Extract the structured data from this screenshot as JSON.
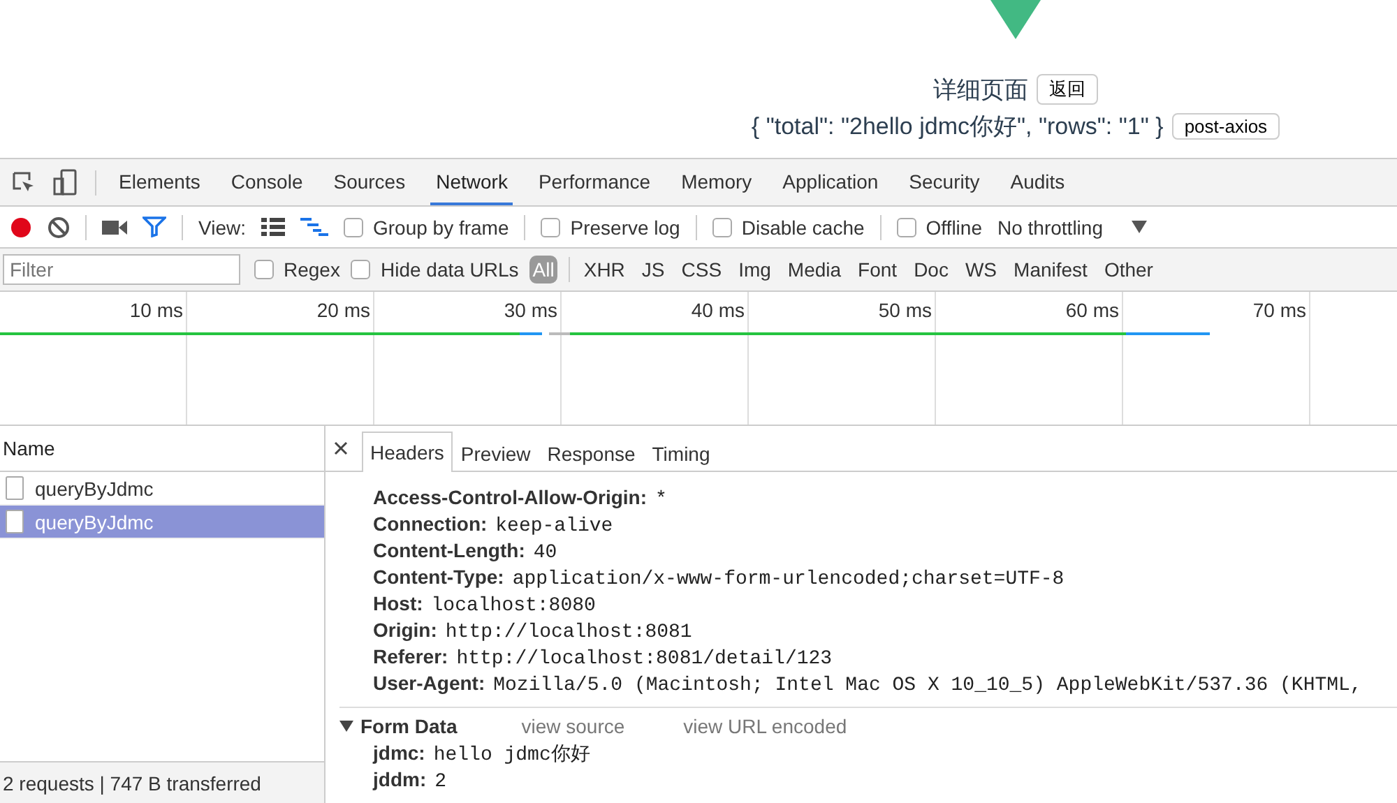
{
  "page": {
    "title": "详细页面",
    "back_button": "返回",
    "result": "{ \"total\": \"2hello jdmc你好\", \"rows\": \"1\" }",
    "post_button": "post-axios"
  },
  "devtools": {
    "tabs": [
      {
        "label": "Elements",
        "selected": false
      },
      {
        "label": "Console",
        "selected": false
      },
      {
        "label": "Sources",
        "selected": false
      },
      {
        "label": "Network",
        "selected": true
      },
      {
        "label": "Performance",
        "selected": false
      },
      {
        "label": "Memory",
        "selected": false
      },
      {
        "label": "Application",
        "selected": false
      },
      {
        "label": "Security",
        "selected": false
      },
      {
        "label": "Audits",
        "selected": false
      }
    ],
    "toolbar": {
      "recording": true,
      "filter_on": true,
      "view_label": "View:",
      "large_rows": false,
      "overview": true,
      "options": [
        {
          "label": "Group by frame",
          "checked": false
        },
        {
          "label": "Preserve log",
          "checked": false
        },
        {
          "label": "Disable cache",
          "checked": false
        },
        {
          "label": "Offline",
          "checked": false
        }
      ],
      "throttling": "No throttling"
    },
    "filter": {
      "placeholder": "Filter",
      "options": [
        {
          "label": "Regex",
          "checked": false
        },
        {
          "label": "Hide data URLs",
          "checked": false
        }
      ],
      "types": [
        {
          "label": "All",
          "selected": true
        },
        {
          "label": "XHR",
          "selected": false
        },
        {
          "label": "JS",
          "selected": false
        },
        {
          "label": "CSS",
          "selected": false
        },
        {
          "label": "Img",
          "selected": false
        },
        {
          "label": "Media",
          "selected": false
        },
        {
          "label": "Font",
          "selected": false
        },
        {
          "label": "Doc",
          "selected": false
        },
        {
          "label": "WS",
          "selected": false
        },
        {
          "label": "Manifest",
          "selected": false
        },
        {
          "label": "Other",
          "selected": false
        }
      ]
    },
    "timeline": {
      "ticks": [
        "10 ms",
        "20 ms",
        "30 ms",
        "40 ms",
        "50 ms",
        "60 ms",
        "70 ms"
      ]
    },
    "requests": {
      "column": "Name",
      "rows": [
        {
          "name": "queryByJdmc",
          "selected": false
        },
        {
          "name": "queryByJdmc",
          "selected": true
        }
      ],
      "status": "2 requests | 747 B transferred"
    },
    "details": {
      "tabs": [
        {
          "label": "Headers",
          "selected": true
        },
        {
          "label": "Preview",
          "selected": false
        },
        {
          "label": "Response",
          "selected": false
        },
        {
          "label": "Timing",
          "selected": false
        }
      ],
      "headers": [
        {
          "name": "Access-Control-Allow-Origin:",
          "value": "*"
        },
        {
          "name": "Connection:",
          "value": "keep-alive"
        },
        {
          "name": "Content-Length:",
          "value": "40"
        },
        {
          "name": "Content-Type:",
          "value": "application/x-www-form-urlencoded;charset=UTF-8"
        },
        {
          "name": "Host:",
          "value": "localhost:8080"
        },
        {
          "name": "Origin:",
          "value": "http://localhost:8081"
        },
        {
          "name": "Referer:",
          "value": "http://localhost:8081/detail/123"
        },
        {
          "name": "User-Agent:",
          "value": "Mozilla/5.0 (Macintosh; Intel Mac OS X 10_10_5) AppleWebKit/537.36 (KHTML,"
        }
      ],
      "form_data": {
        "title": "Form Data",
        "expanded": true,
        "links": [
          "view source",
          "view URL encoded"
        ],
        "params": [
          {
            "name": "jdmc:",
            "value": "hello jdmc你好"
          },
          {
            "name": "jddm:",
            "value": "2"
          }
        ]
      }
    }
  }
}
